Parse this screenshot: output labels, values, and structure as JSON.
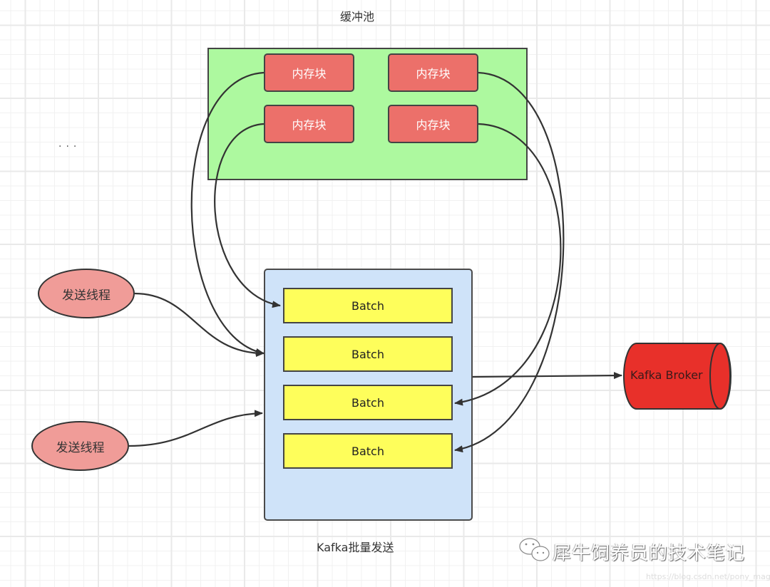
{
  "buffer_pool": {
    "title": "缓冲池",
    "blocks": [
      {
        "label": "内存块"
      },
      {
        "label": "内存块"
      },
      {
        "label": "内存块"
      },
      {
        "label": "内存块"
      }
    ]
  },
  "ellipsis": "...",
  "batch_container": {
    "title": "Kafka批量发送",
    "batches": [
      {
        "label": "Batch"
      },
      {
        "label": "Batch"
      },
      {
        "label": "Batch"
      },
      {
        "label": "Batch"
      }
    ]
  },
  "threads": [
    {
      "label": "发送线程"
    },
    {
      "label": "发送线程"
    }
  ],
  "broker": {
    "label": "Kafka Broker"
  },
  "watermark": {
    "text": "犀牛饲养员的技术笔记",
    "url": "https://blog.csdn.net/pony_maggie",
    "icon": "wechat-icon"
  },
  "colors": {
    "buffer_pool": "#adf99f",
    "memory_block": "#ec706a",
    "batch_container": "#cfe3f9",
    "batch": "#fefe5b",
    "thread": "#f09c98",
    "broker": "#e8302a"
  }
}
